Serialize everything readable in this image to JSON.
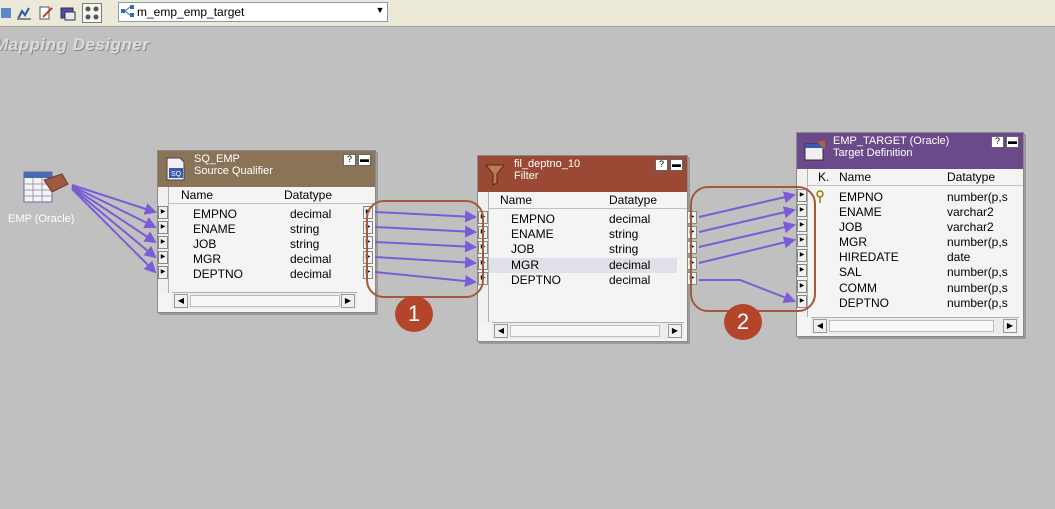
{
  "toolbar": {
    "icons": [
      "source-analyzer-icon",
      "target-designer-icon",
      "transformation-developer-icon",
      "mapplet-designer-icon",
      "mapping-designer-icon"
    ],
    "mapping_select": {
      "value": "m_emp_emp_target"
    }
  },
  "canvas": {
    "title": "Mapping Designer",
    "source": {
      "label": "EMP (Oracle)"
    }
  },
  "sq": {
    "name": "SQ_EMP",
    "type": "Source Qualifier",
    "header": {
      "name": "Name",
      "datatype": "Datatype"
    },
    "rows": [
      {
        "name": "EMPNO",
        "dtype": "decimal"
      },
      {
        "name": "ENAME",
        "dtype": "string"
      },
      {
        "name": "JOB",
        "dtype": "string"
      },
      {
        "name": "MGR",
        "dtype": "decimal"
      },
      {
        "name": "DEPTNO",
        "dtype": "decimal"
      }
    ],
    "colors": {
      "header": "#8a7357"
    }
  },
  "filter": {
    "name": "fil_deptno_10",
    "type": "Filter",
    "header": {
      "name": "Name",
      "datatype": "Datatype"
    },
    "rows": [
      {
        "name": "EMPNO",
        "dtype": "decimal"
      },
      {
        "name": "ENAME",
        "dtype": "string"
      },
      {
        "name": "JOB",
        "dtype": "string"
      },
      {
        "name": "MGR",
        "dtype": "decimal"
      },
      {
        "name": "DEPTNO",
        "dtype": "decimal"
      }
    ],
    "colors": {
      "header": "#9a4a34"
    }
  },
  "target": {
    "name": "EMP_TARGET (Oracle)",
    "type": "Target Definition",
    "header": {
      "key": "K.",
      "name": "Name",
      "datatype": "Datatype"
    },
    "rows": [
      {
        "name": "EMPNO",
        "dtype": "number(p,s"
      },
      {
        "name": "ENAME",
        "dtype": "varchar2"
      },
      {
        "name": "JOB",
        "dtype": "varchar2"
      },
      {
        "name": "MGR",
        "dtype": "number(p,s"
      },
      {
        "name": "HIREDATE",
        "dtype": "date"
      },
      {
        "name": "SAL",
        "dtype": "number(p,s"
      },
      {
        "name": "COMM",
        "dtype": "number(p,s"
      },
      {
        "name": "DEPTNO",
        "dtype": "number(p,s"
      }
    ],
    "colors": {
      "header": "#6a4a8a"
    }
  },
  "annotations": {
    "badge1": "1",
    "badge2": "2"
  },
  "colors": {
    "link": "#7b5cd6",
    "callout": "#a45a3a",
    "badge": "#b5452a",
    "canvas": "#c0c0c0"
  }
}
